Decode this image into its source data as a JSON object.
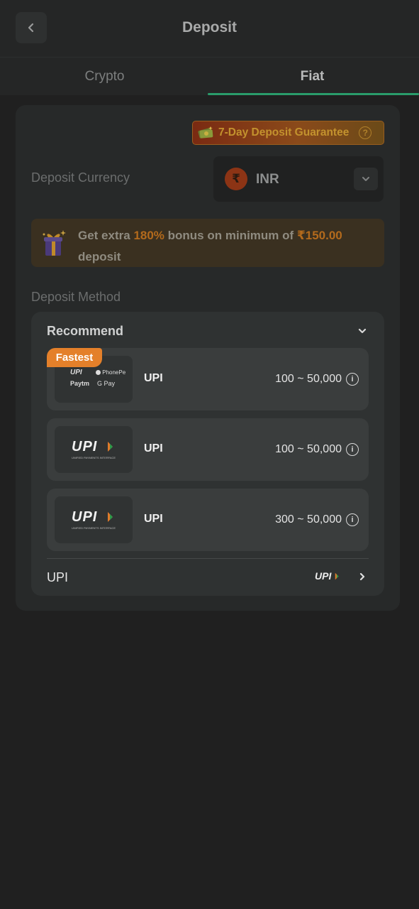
{
  "header": {
    "title": "Deposit"
  },
  "tabs": [
    {
      "label": "Crypto",
      "active": false
    },
    {
      "label": "Fiat",
      "active": true
    }
  ],
  "guarantee": {
    "label": "7-Day Deposit Guarantee",
    "help": "?"
  },
  "currency": {
    "label": "Deposit Currency",
    "symbol": "₹",
    "code": "INR"
  },
  "bonus": {
    "prefix": "Get extra ",
    "percent": "180%",
    "middle": " bonus on minimum of ",
    "amount": "₹150.00",
    "suffix": " deposit"
  },
  "method": {
    "label": "Deposit Method",
    "section_title": "Recommend",
    "cards": [
      {
        "badge": "Fastest",
        "name": "UPI",
        "range": "100 ~ 50,000",
        "logo": "multi",
        "logo_texts": [
          "UPI",
          "PhonePe",
          "Paytm",
          "G Pay"
        ]
      },
      {
        "name": "UPI",
        "range": "100 ~ 50,000",
        "logo": "upi",
        "logo_sub": "UNIFIED PAYMENTS INTERFACE"
      },
      {
        "name": "UPI",
        "range": "300 ~ 50,000",
        "logo": "upi",
        "logo_sub": "UNIFIED PAYMENTS INTERFACE"
      }
    ],
    "footer": {
      "label": "UPI",
      "logo_text": "UPI"
    }
  },
  "colors": {
    "accent_green": "#2a9c6b",
    "badge_orange": "#e4802a",
    "bonus_highlight": "#b36a1c"
  },
  "icons": {
    "back": "chevron-left-icon",
    "dropdown": "chevron-down-icon",
    "info": "info-icon",
    "next": "chevron-right-icon",
    "gift": "gift-icon"
  }
}
